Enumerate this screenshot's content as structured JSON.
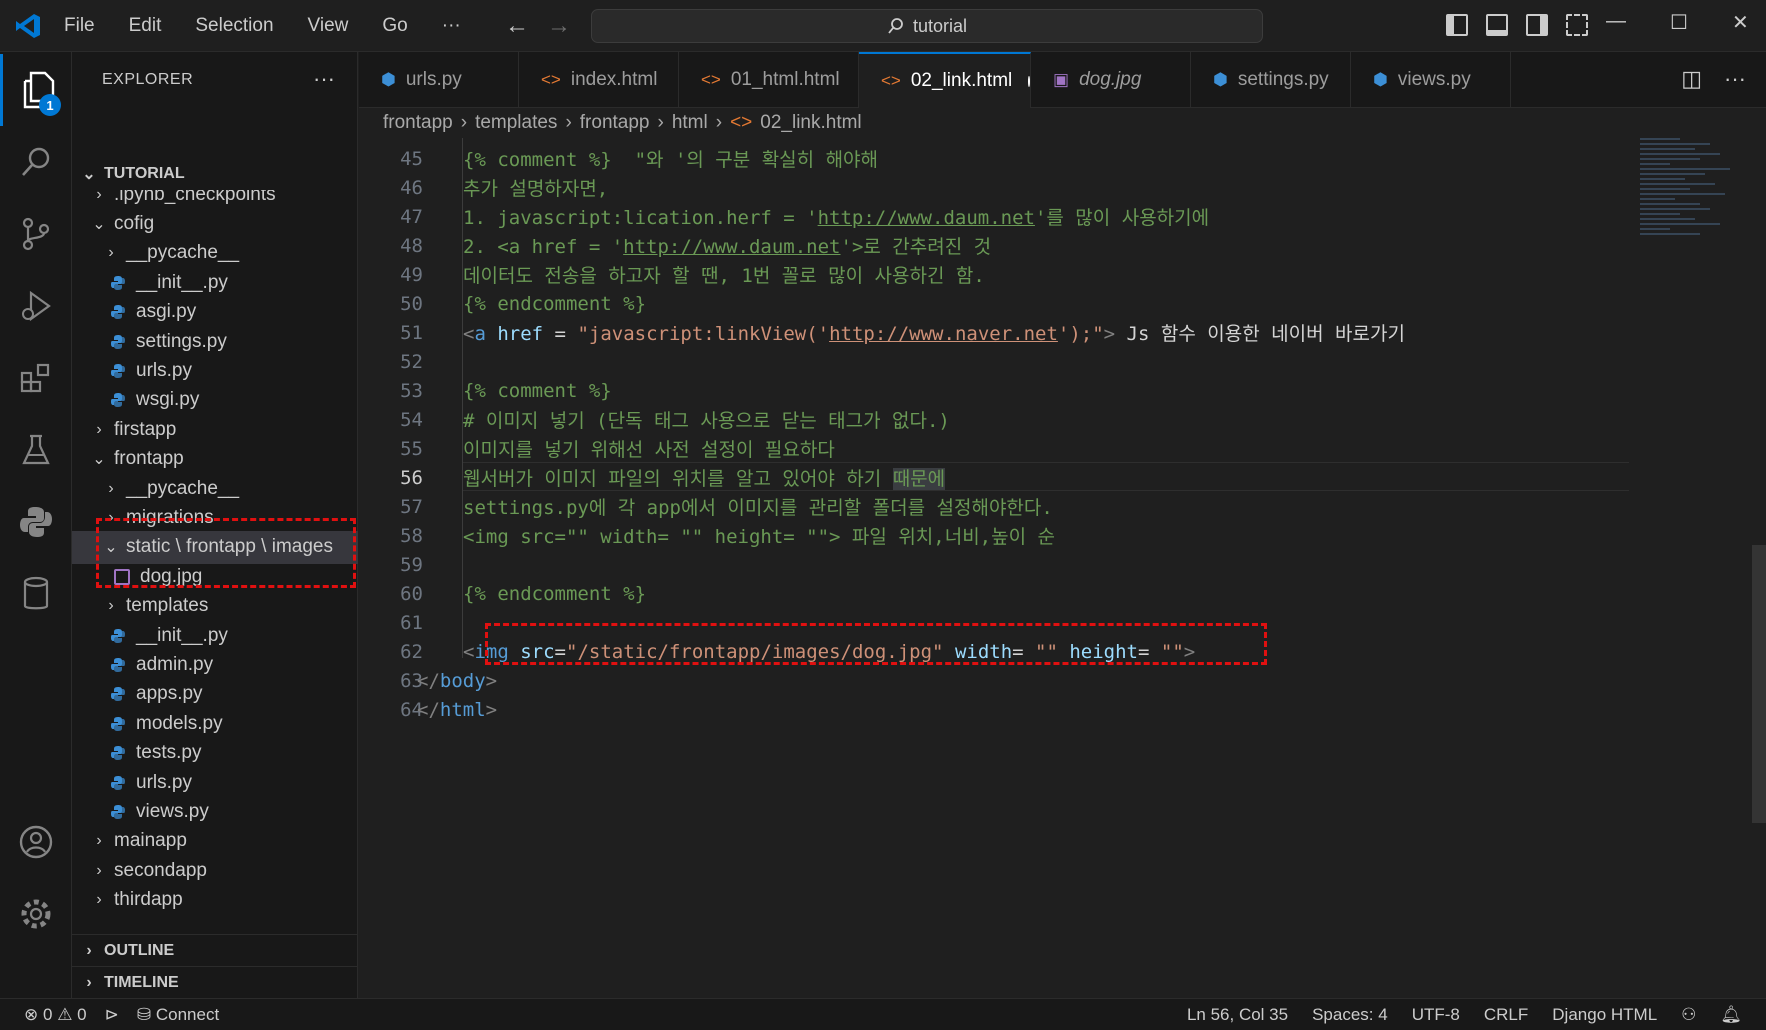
{
  "titlebar": {
    "menu": [
      "File",
      "Edit",
      "Selection",
      "View",
      "Go",
      "···"
    ],
    "search_text": "tutorial"
  },
  "activity": {
    "explorer_badge": "1"
  },
  "sidebar": {
    "title": "EXPLORER",
    "more": "···",
    "root": "TUTORIAL",
    "tree": [
      {
        "label": ".ipynb_checkpoints",
        "type": "folder",
        "expanded": false,
        "depth": 1
      },
      {
        "label": "cofig",
        "type": "folder",
        "expanded": true,
        "depth": 1
      },
      {
        "label": "__pycache__",
        "type": "folder",
        "expanded": false,
        "depth": 2
      },
      {
        "label": "__init__.py",
        "type": "py",
        "depth": 2
      },
      {
        "label": "asgi.py",
        "type": "py",
        "depth": 2
      },
      {
        "label": "settings.py",
        "type": "py",
        "depth": 2
      },
      {
        "label": "urls.py",
        "type": "py",
        "depth": 2
      },
      {
        "label": "wsgi.py",
        "type": "py",
        "depth": 2
      },
      {
        "label": "firstapp",
        "type": "folder",
        "expanded": false,
        "depth": 1
      },
      {
        "label": "frontapp",
        "type": "folder",
        "expanded": true,
        "depth": 1
      },
      {
        "label": "__pycache__",
        "type": "folder",
        "expanded": false,
        "depth": 2
      },
      {
        "label": "migrations",
        "type": "folder",
        "expanded": false,
        "depth": 2
      },
      {
        "label": "static \\ frontapp \\ images",
        "type": "folder",
        "expanded": true,
        "depth": 2
      },
      {
        "label": "dog.jpg",
        "type": "img",
        "depth": 3
      },
      {
        "label": "templates",
        "type": "folder",
        "expanded": false,
        "depth": 2
      },
      {
        "label": "__init__.py",
        "type": "py",
        "depth": 2
      },
      {
        "label": "admin.py",
        "type": "py",
        "depth": 2
      },
      {
        "label": "apps.py",
        "type": "py",
        "depth": 2
      },
      {
        "label": "models.py",
        "type": "py",
        "depth": 2
      },
      {
        "label": "tests.py",
        "type": "py",
        "depth": 2
      },
      {
        "label": "urls.py",
        "type": "py",
        "depth": 2
      },
      {
        "label": "views.py",
        "type": "py",
        "depth": 2
      },
      {
        "label": "mainapp",
        "type": "folder",
        "expanded": false,
        "depth": 1
      },
      {
        "label": "secondapp",
        "type": "folder",
        "expanded": false,
        "depth": 1
      },
      {
        "label": "thirdapp",
        "type": "folder",
        "expanded": false,
        "depth": 1
      }
    ],
    "outline": "OUTLINE",
    "timeline": "TIMELINE"
  },
  "tabs": [
    {
      "label": "urls.py",
      "kind": "py"
    },
    {
      "label": "index.html",
      "kind": "html"
    },
    {
      "label": "01_html.html",
      "kind": "html"
    },
    {
      "label": "02_link.html",
      "kind": "html",
      "active": true,
      "dirty": true
    },
    {
      "label": "dog.jpg",
      "kind": "img"
    },
    {
      "label": "settings.py",
      "kind": "py"
    },
    {
      "label": "views.py",
      "kind": "py"
    }
  ],
  "breadcrumb": [
    "frontapp",
    "templates",
    "frontapp",
    "html",
    "02_link.html"
  ],
  "editor": {
    "lines": {
      "45": "{% comment %}  \"와 '의 구분 확실히 해야해",
      "46": "추가 설명하자면,",
      "47a": "1. javascript:lication.herf = '",
      "47b": "http://www.daum.net",
      "47c": "'를 많이 사용하기에",
      "48a": "2. <a href = '",
      "48b": "http://www.daum.net",
      "48c": "'>로 간추려진 것",
      "49": "데이터도 전송을 하고자 할 땐, 1번 꼴로 많이 사용하긴 함.",
      "50": "{% endcomment %}",
      "51a": "<",
      "51b": "a",
      "51c": " href",
      "51d": " = ",
      "51e": "\"javascript:linkView('",
      "51f": "http://www.naver.net",
      "51g": "');\"",
      "51h": ">",
      "51i": " Js 함수 이용한 네이버 바로가기",
      "53": "{% comment %}",
      "54": "# 이미지 넣기 (단독 태그 사용으로 닫는 태그가 없다.)",
      "55": "이미지를 넣기 위해선 사전 설정이 필요하다",
      "56a": "웹서버가 이미지 파일의 위치를 알고 있어야 하기 ",
      "56b": "때문에",
      "57": "settings.py에 각 app에서 이미지를 관리할 폴더를 설정해야한다.",
      "58": "<img src=\"\" width= \"\" height= \"\"> 파일 위치,너비,높이 순",
      "60": "{% endcomment %}",
      "62a": "<",
      "62b": "img",
      "62c": " src",
      "62d": "=",
      "62e": "\"/static/frontapp/images/dog.jpg\"",
      "62f": " width",
      "62g": "= ",
      "62h": "\"\"",
      "62i": " height",
      "62j": "= ",
      "62k": "\"\"",
      "62l": ">",
      "63a": "</",
      "63b": "body",
      "63c": ">",
      "64a": "</",
      "64b": "html",
      "64c": ">"
    },
    "line_numbers": [
      "45",
      "46",
      "47",
      "48",
      "49",
      "50",
      "51",
      "52",
      "53",
      "54",
      "55",
      "56",
      "57",
      "58",
      "59",
      "60",
      "61",
      "62",
      "63",
      "64"
    ],
    "current_line": "56"
  },
  "status": {
    "errors": "0",
    "warnings": "0",
    "connect": "Connect",
    "position": "Ln 56, Col 35",
    "spaces": "Spaces: 4",
    "encoding": "UTF-8",
    "eol": "CRLF",
    "language": "Django HTML"
  },
  "colors": {
    "accent": "#0078d4",
    "highlight_box": "#e01010",
    "comment": "#6a9955",
    "tag": "#569cd6",
    "attr": "#9cdcfe",
    "string": "#ce9178"
  }
}
